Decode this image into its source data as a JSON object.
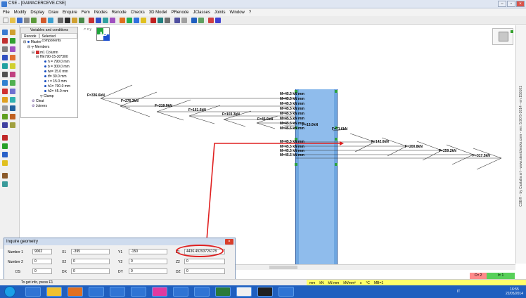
{
  "window": {
    "title": "CSE - [GAMACERCEVE.CSE]"
  },
  "menu": [
    "File",
    "Modify",
    "Display",
    "Draw",
    "Enquire",
    "Fem",
    "INodes",
    "Renode",
    "Checks",
    "3D Model",
    "PRenode",
    "JClasses",
    "Joints",
    "Window",
    "?"
  ],
  "panel": {
    "header": "Variables and conditions",
    "tabs": [
      "Renode",
      "Selected components"
    ],
    "tree": {
      "master": "Master",
      "members": "Members",
      "column": "m1 Column",
      "section": "HE790-15-30*300",
      "props": [
        "h = 790.0 mm",
        "b = 300.0 mm",
        "tw= 15.0 mm",
        "tf= 30.0 mm",
        "r = 15.0 mm",
        "h1= 700.0 mm",
        "h2= 45.0 mm"
      ],
      "clamp": "Clamp",
      "cleat": "Cleat",
      "joiners": "Joiners"
    }
  },
  "canvas": {
    "badge": "AB",
    "forces": [
      "F=336.6kN",
      "F=276.3kN",
      "F=219.9kN",
      "F=161.6kN",
      "F=103.3kN",
      "F=45.0kN",
      "F=15.0kN",
      "F=71.6kN",
      "F=142.6kN",
      "F=200.8kN",
      "F=259.2kN",
      "F=317.5kN"
    ],
    "moment": "M=45.5 kN mm"
  },
  "right_vertical_text": "CSE® - by Castalia srl - www.steelchecks.com - ver. 5.90 5-2014 - en 150101",
  "dialog": {
    "title": "Inquire geometry",
    "rows": [
      {
        "label": "Number 1",
        "value": "9002",
        "fields": [
          {
            "label": "X1",
            "value": "-395"
          },
          {
            "label": "Y1",
            "value": "-150"
          },
          {
            "label": "Z1",
            "value": "4436.49293726178"
          }
        ]
      },
      {
        "label": "Number 2",
        "value": "0",
        "fields": [
          {
            "label": "X2",
            "value": "0"
          },
          {
            "label": "Y2",
            "value": "0"
          },
          {
            "label": "Z2",
            "value": "0"
          }
        ]
      },
      {
        "label": "DS",
        "value": "0",
        "fields": [
          {
            "label": "DX",
            "value": "0"
          },
          {
            "label": "DY",
            "value": "0"
          },
          {
            "label": "DZ",
            "value": "0"
          }
        ]
      }
    ]
  },
  "status": {
    "hint": "To get info, press F1",
    "units": [
      "mm",
      "kN",
      "kN mm",
      "kN/mm²",
      "s",
      "°C",
      "MB=1"
    ],
    "red_badge": "C= 2",
    "green_badge": "I= 1"
  },
  "taskbar": {
    "clock_time": "16:55",
    "clock_date": "22/05/2014",
    "lang": "IT"
  },
  "colors": {
    "column": "#6fa6e0",
    "arrow": "#e02020",
    "units_bar": "#ffff6a"
  }
}
